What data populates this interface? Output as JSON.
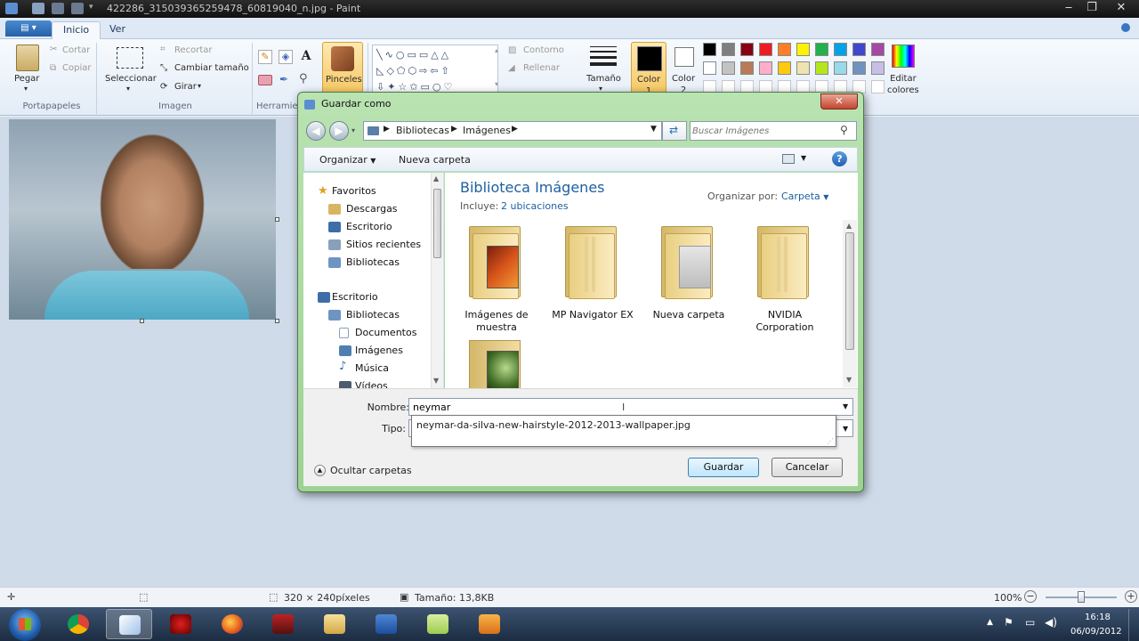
{
  "window": {
    "title": "422286_315039365259478_60819040_n.jpg - Paint",
    "controls": {
      "minimize": "‒",
      "maximize": "❐",
      "close": "✕"
    }
  },
  "ribbon": {
    "tabs": [
      "Inicio",
      "Ver"
    ],
    "portapapeles": {
      "paste": "Pegar",
      "cut": "Cortar",
      "copy": "Copiar",
      "group": "Portapapeles"
    },
    "imagen": {
      "select": "Seleccionar",
      "crop": "Recortar",
      "resize": "Cambiar tamaño",
      "rotate": "Girar",
      "group": "Imagen"
    },
    "herramientas": {
      "group": "Herramie"
    },
    "brushes": "Pinceles",
    "shapes": {
      "outline": "Contorno",
      "fill": "Rellenar"
    },
    "size": "Tamaño",
    "color1": "Color\n1",
    "color2": "Color\n2",
    "edit_colors": "Editar\ncolores",
    "palette_row1": [
      "#000000",
      "#7f7f7f",
      "#880015",
      "#ed1c24",
      "#ff7f27",
      "#fff200",
      "#22b14c",
      "#00a2e8",
      "#3f48cc",
      "#a349a4"
    ],
    "palette_row2": [
      "#ffffff",
      "#c3c3c3",
      "#b97a57",
      "#ffaec9",
      "#ffc90e",
      "#efe4b0",
      "#b5e61d",
      "#99d9ea",
      "#7092be",
      "#c8bfe7"
    ]
  },
  "dialog": {
    "title": "Guardar como",
    "address": [
      "Bibliotecas",
      "Imágenes"
    ],
    "search_placeholder": "Buscar Imágenes",
    "organize": "Organizar",
    "new_folder": "Nueva carpeta",
    "nav": {
      "favorites": "Favoritos",
      "downloads": "Descargas",
      "desktop": "Escritorio",
      "recent": "Sitios recientes",
      "libraries": "Bibliotecas",
      "desktop2": "Escritorio",
      "libraries2": "Bibliotecas",
      "documents": "Documentos",
      "images": "Imágenes",
      "music": "Música",
      "videos": "Vídeos"
    },
    "library_title": "Biblioteca Imágenes",
    "includes_label": "Incluye:",
    "includes_link": "2 ubicaciones",
    "arrange_label": "Organizar por:",
    "arrange_value": "Carpeta",
    "folders": [
      "Imágenes de\nmuestra",
      "MP Navigator EX",
      "Nueva carpeta",
      "NVIDIA\nCorporation"
    ],
    "filename_label": "Nombre:",
    "filename_value": "neymar",
    "filetype_label": "Tipo:",
    "autocomplete": "neymar-da-silva-new-hairstyle-2012-2013-wallpaper.jpg",
    "hide_folders": "Ocultar carpetas",
    "save": "Guardar",
    "cancel": "Cancelar"
  },
  "status": {
    "dimensions": "320 × 240píxeles",
    "size": "Tamaño: 13,8KB",
    "zoom": "100%"
  },
  "taskbar": {
    "time": "16:18",
    "date": "06/09/2012"
  }
}
